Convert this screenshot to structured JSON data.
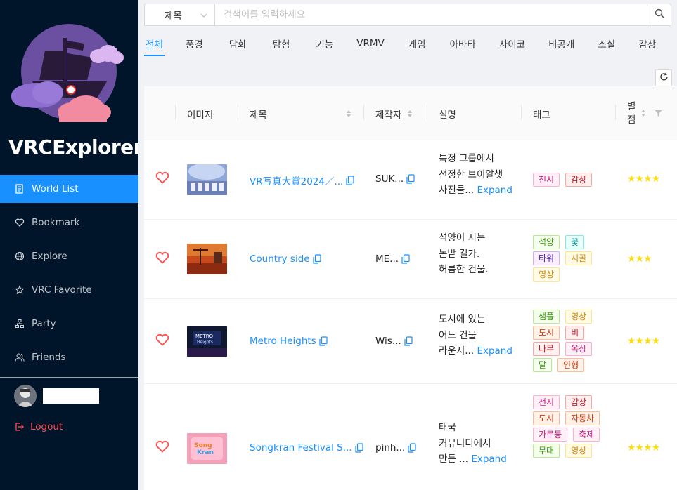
{
  "app": {
    "title": "VRCExplorer"
  },
  "sidebar": {
    "items": [
      {
        "label": "World List",
        "icon": "list-icon",
        "active": true
      },
      {
        "label": "Bookmark",
        "icon": "heart-icon",
        "active": false
      },
      {
        "label": "Explore",
        "icon": "globe-icon",
        "active": false
      },
      {
        "label": "VRC Favorite",
        "icon": "star-icon",
        "active": false
      },
      {
        "label": "Party",
        "icon": "team-icon",
        "active": false
      },
      {
        "label": "Friends",
        "icon": "users-icon",
        "active": false
      }
    ],
    "logout_label": "Logout"
  },
  "search": {
    "field_selected": "제목",
    "placeholder": "검색어를 입력하세요"
  },
  "tabs": [
    "전체",
    "풍경",
    "담화",
    "탐험",
    "기능",
    "VRMV",
    "게임",
    "아바타",
    "사이코",
    "비공개",
    "소실",
    "감상"
  ],
  "active_tab": "전체",
  "table": {
    "headers": {
      "image": "이미지",
      "title": "제목",
      "creator": "제작자",
      "description": "설명",
      "tags": "태그",
      "rating_line1": "별",
      "rating_line2": "점"
    },
    "expand_label": "Expand",
    "rows": [
      {
        "title": "VR写真大賞2024／...",
        "creator": "SUK...",
        "desc_lines": [
          "특정 그룹에서",
          "선정한 브이알챗",
          "사진들..."
        ],
        "tags": [
          {
            "text": "전시",
            "color": "magenta"
          },
          {
            "text": "감상",
            "color": "red"
          }
        ],
        "stars": "★★★★"
      },
      {
        "title": "Country side",
        "creator": "ME...",
        "desc_lines": [
          "석양이 지는",
          "논밭 길가.",
          "허름한 건물."
        ],
        "tags": [
          {
            "text": "석양",
            "color": "green"
          },
          {
            "text": "꽃",
            "color": "cyan"
          },
          {
            "text": "타워",
            "color": "purple"
          },
          {
            "text": "시골",
            "color": "gold"
          },
          {
            "text": "영상",
            "color": "gold"
          }
        ],
        "stars": "★★★"
      },
      {
        "title": "Metro Heights",
        "creator": "Wis...",
        "desc_lines": [
          "도시에 있는",
          "어느 건물",
          "라운지..."
        ],
        "tags": [
          {
            "text": "샘플",
            "color": "green"
          },
          {
            "text": "영상",
            "color": "gold"
          },
          {
            "text": "도시",
            "color": "volcano"
          },
          {
            "text": "비",
            "color": "red"
          },
          {
            "text": "나무",
            "color": "red"
          },
          {
            "text": "옥상",
            "color": "magenta"
          },
          {
            "text": "달",
            "color": "green"
          },
          {
            "text": "인형",
            "color": "volcano"
          }
        ],
        "stars": "★★★★"
      },
      {
        "title": "Songkran Festival S...",
        "creator": "pinh...",
        "desc_lines": [
          "태국",
          "커뮤니티에서",
          "만든 ..."
        ],
        "tags": [
          {
            "text": "전시",
            "color": "magenta"
          },
          {
            "text": "감상",
            "color": "red"
          },
          {
            "text": "도시",
            "color": "volcano"
          },
          {
            "text": "자동차",
            "color": "volcano"
          },
          {
            "text": "가로등",
            "color": "magenta"
          },
          {
            "text": "축제",
            "color": "magenta"
          },
          {
            "text": "무대",
            "color": "green"
          },
          {
            "text": "영상",
            "color": "gold"
          }
        ],
        "stars": "★★★★"
      }
    ]
  }
}
